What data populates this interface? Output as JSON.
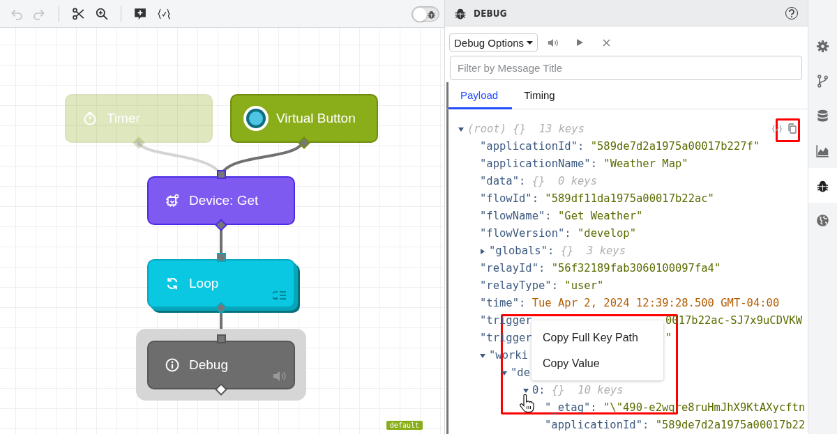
{
  "toolbar": {
    "tools": [
      {
        "kind": "undo",
        "disabled": true
      },
      {
        "kind": "redo",
        "disabled": true
      },
      {
        "kind": "cut",
        "disabled": false
      },
      {
        "kind": "zoom",
        "disabled": false
      },
      {
        "kind": "comment",
        "disabled": false
      },
      {
        "kind": "validate",
        "disabled": false
      }
    ],
    "debug_toggle": {
      "on": false
    }
  },
  "canvas": {
    "nodes": [
      {
        "label": "Timer",
        "kind": "timer",
        "disabled": true,
        "selected": false
      },
      {
        "label": "Virtual Button",
        "kind": "button",
        "disabled": false,
        "selected": false
      },
      {
        "label": "Device: Get",
        "kind": "device",
        "disabled": false,
        "selected": false
      },
      {
        "label": "Loop",
        "kind": "loop",
        "disabled": false,
        "selected": false
      },
      {
        "label": "Debug",
        "kind": "debug",
        "disabled": false,
        "selected": true
      }
    ],
    "version_badge": "default"
  },
  "debug_panel": {
    "title": "DEBUG",
    "options_button": "Debug Options",
    "filter": {
      "placeholder": "Filter by Message Title"
    },
    "tabs": [
      {
        "label": "Payload",
        "selected": true
      },
      {
        "label": "Timing",
        "selected": false
      }
    ],
    "tree": {
      "key": "(root)",
      "kind": "root",
      "summary": "{}  13 keys",
      "expanded": true,
      "children": [
        {
          "key": "\"applicationId\":",
          "value": "\"589de7d2a1975a00017b227f\"",
          "kind": "string"
        },
        {
          "key": "\"applicationName\":",
          "value": "\"Weather Map\"",
          "kind": "string"
        },
        {
          "key": "\"data\":",
          "summary": "{}  0 keys",
          "kind": "leaf_object"
        },
        {
          "key": "\"flowId\":",
          "value": "\"589df11da1975a00017b22ac\"",
          "kind": "string"
        },
        {
          "key": "\"flowName\":",
          "value": "\"Get Weather\"",
          "kind": "string"
        },
        {
          "key": "\"flowVersion\":",
          "value": "\"develop\"",
          "kind": "string"
        },
        {
          "key": "\"globals\":",
          "summary": "{}  3 keys",
          "kind": "object",
          "expanded": false
        },
        {
          "key": "\"relayId\":",
          "value": "\"56f32189fab3060100097fa4\"",
          "kind": "string"
        },
        {
          "key": "\"relayType\":",
          "value": "\"user\"",
          "kind": "string"
        },
        {
          "key": "\"time\":",
          "value": "Tue Apr 2, 2024 12:39:28.500 GMT-04:00",
          "kind": "date"
        },
        {
          "key": "\"trigger",
          "value": "0017b22ac-SJ7x9uCDVKW",
          "kind": "clipped"
        },
        {
          "key": "\"trigger",
          "value": "\"",
          "kind": "clipped"
        },
        {
          "key": "\"worki",
          "kind": "object",
          "expanded": true,
          "children": [
            {
              "key": "\"de",
              "kind": "object",
              "expanded": true,
              "children": [
                {
                  "key": "0:",
                  "summary": "{}  10 keys",
                  "kind": "object",
                  "expanded": true,
                  "children": [
                    {
                      "key": "\"_etag\":",
                      "value": "\"\\\"490-e2wqre8ruHmJhX9KtAXycftn",
                      "kind": "string"
                    },
                    {
                      "key": "\"applicationId\":",
                      "value": "\"589de7d2a1975a00017b22",
                      "kind": "string"
                    }
                  ]
                }
              ]
            }
          ]
        }
      ]
    },
    "context_menu": {
      "items": [
        "Copy Full Key Path",
        "Copy Value"
      ]
    }
  },
  "side_rail": {
    "items": [
      {
        "kind": "settings",
        "selected": false
      },
      {
        "kind": "branch",
        "selected": false
      },
      {
        "kind": "database",
        "selected": false
      },
      {
        "kind": "chart",
        "selected": false
      },
      {
        "kind": "debug",
        "selected": true
      },
      {
        "kind": "globe",
        "selected": false
      }
    ]
  }
}
